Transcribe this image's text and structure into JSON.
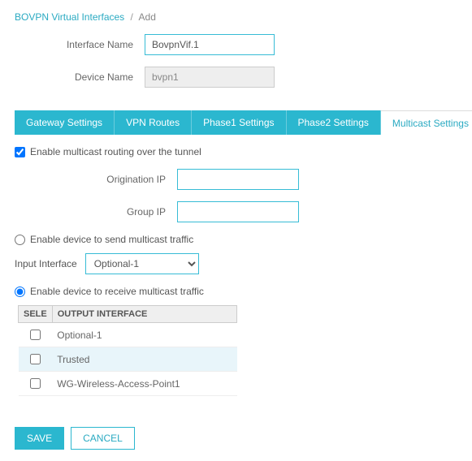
{
  "breadcrumb": {
    "root": "BOVPN Virtual Interfaces",
    "current": "Add"
  },
  "header_form": {
    "interface_name_label": "Interface Name",
    "interface_name_value": "BovpnVif.1",
    "device_name_label": "Device Name",
    "device_name_value": "bvpn1"
  },
  "tabs": {
    "gateway": "Gateway Settings",
    "vpn_routes": "VPN Routes",
    "phase1": "Phase1 Settings",
    "phase2": "Phase2 Settings",
    "multicast": "Multicast Settings"
  },
  "enable_multicast_label": "Enable multicast routing over the tunnel",
  "origination_ip_label": "Origination IP",
  "origination_ip_value": "",
  "group_ip_label": "Group IP",
  "group_ip_value": "",
  "send_label": "Enable device to send multicast traffic",
  "input_interface_label": "Input Interface",
  "input_interface_value": "Optional-1",
  "receive_label": "Enable device to receive multicast traffic",
  "table": {
    "col_select": "SELE",
    "col_output": "OUTPUT INTERFACE",
    "rows": [
      {
        "name": "Optional-1",
        "selected": false
      },
      {
        "name": "Trusted",
        "selected": false
      },
      {
        "name": "WG-Wireless-Access-Point1",
        "selected": false
      }
    ]
  },
  "buttons": {
    "save": "SAVE",
    "cancel": "CANCEL"
  }
}
